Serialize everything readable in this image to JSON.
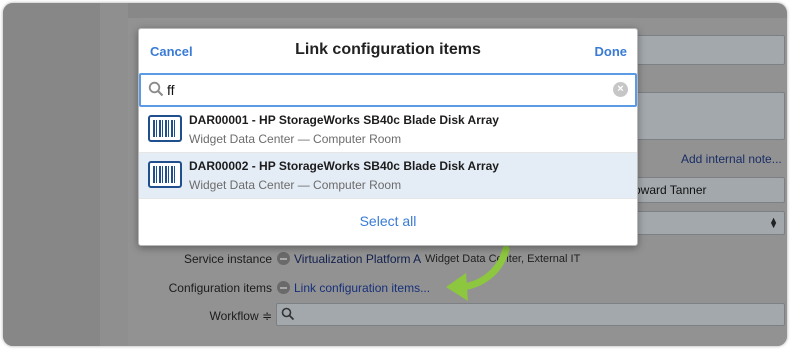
{
  "modal": {
    "cancel_label": "Cancel",
    "title": "Link configuration items",
    "done_label": "Done",
    "search_value": "ff",
    "clear_symbol": "×",
    "results": [
      {
        "title": "DAR00001 - HP StorageWorks SB40c Blade Disk Array",
        "subtitle": "Widget Data Center — Computer Room"
      },
      {
        "title": "DAR00002 - HP StorageWorks SB40c Blade Disk Array",
        "subtitle": "Widget Data Center — Computer Room"
      }
    ],
    "select_all_label": "Select all"
  },
  "background": {
    "add_internal_note": "Add internal note...",
    "assignee_partial": "oward Tanner",
    "service_instance_label": "Service instance",
    "service_instance_value": "Virtualization Platform A",
    "service_instance_sub": "Widget Data Center, External IT",
    "configuration_items_label": "Configuration items",
    "link_configuration_items": "Link configuration items...",
    "workflow_label": "Workflow ≑"
  },
  "colors": {
    "accent_blue": "#3a7bd5",
    "highlight_row": "#e4ecf5",
    "arrow_green": "#8dc63f",
    "overlay_gray": "#929292"
  },
  "icons": {
    "search": "search-icon",
    "clear": "clear-search-icon",
    "result_item": "barcode-icon",
    "pointer": "green-arrow-icon"
  }
}
